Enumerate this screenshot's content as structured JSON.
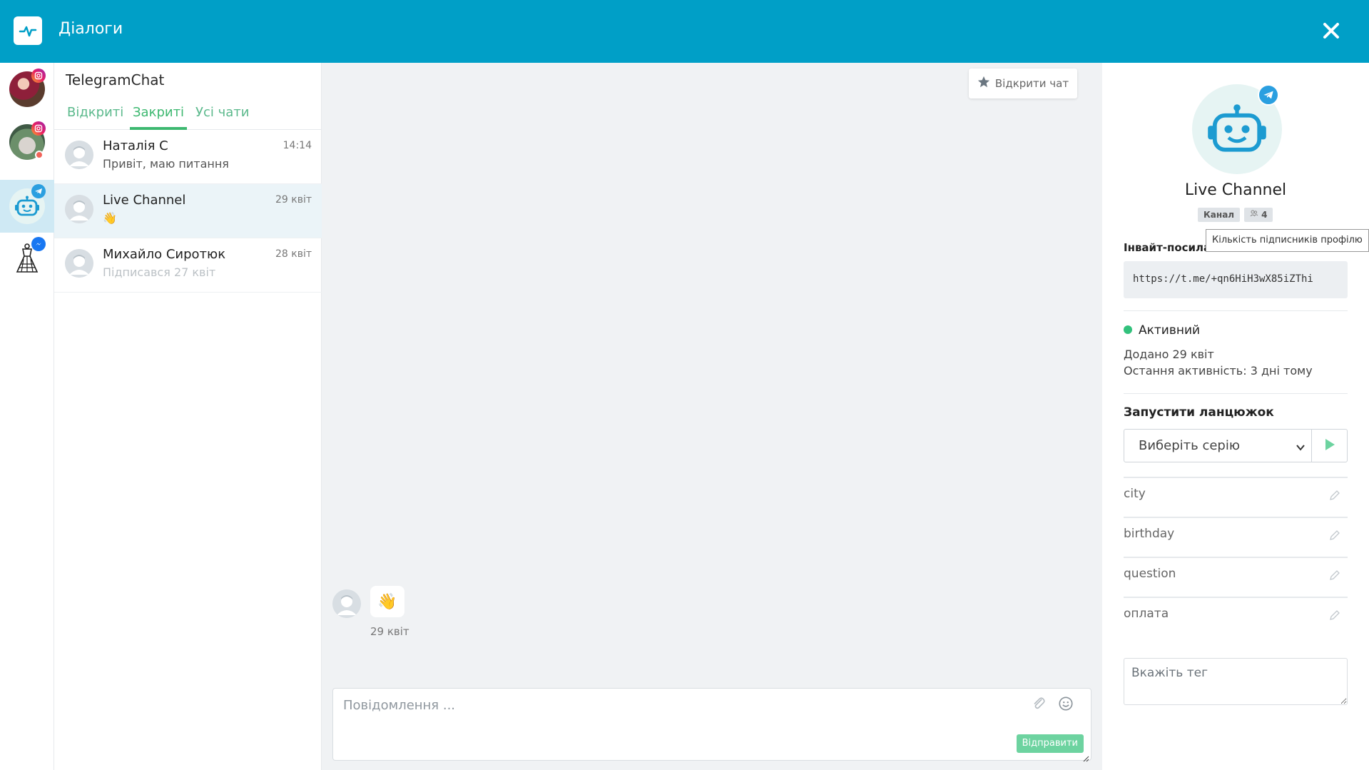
{
  "header": {
    "title": "Діалоги"
  },
  "list": {
    "title": "TelegramChat",
    "tabs": [
      {
        "label": "Відкриті"
      },
      {
        "label": "Закриті"
      },
      {
        "label": "Усі чати"
      }
    ],
    "dialogs": [
      {
        "name": "Наталія С",
        "message": "Привіт, маю питання",
        "time": "14:14"
      },
      {
        "name": "Live Channel",
        "message": "👋",
        "time": "29 квіт"
      },
      {
        "name": "Михайло Сиротюк",
        "message": "Підписався 27 квіт",
        "time": "28 квіт"
      }
    ]
  },
  "chat": {
    "open_chat_label": "Відкрити чат",
    "messages": [
      {
        "text": "👋",
        "date": "29 квіт"
      }
    ],
    "composer_placeholder": "Повідомлення ...",
    "send_label": "Відправити"
  },
  "profile": {
    "name": "Live Channel",
    "type_tag": "Канал",
    "subscribers": "4",
    "subscribers_tooltip": "Кількість підписників профілю",
    "invite_label": "Інвайт-посилання",
    "invite_link": "https://t.me/+qn6HiH3wX85iZThi",
    "status": "Активний",
    "added": "Додано 29 квіт",
    "last_activity": "Остання активність: 3 дні тому",
    "chain_label": "Запустити ланцюжок",
    "chain_select": "Виберіть серію",
    "fields": [
      {
        "name": "city"
      },
      {
        "name": "birthday"
      },
      {
        "name": "question"
      },
      {
        "name": "оплата"
      }
    ],
    "tag_placeholder": "Вкажіть тег"
  },
  "colors": {
    "header": "#009fc7",
    "accent_green": "#3db870",
    "active_rail": "#cfe9f4",
    "status_green": "#32c17c"
  }
}
